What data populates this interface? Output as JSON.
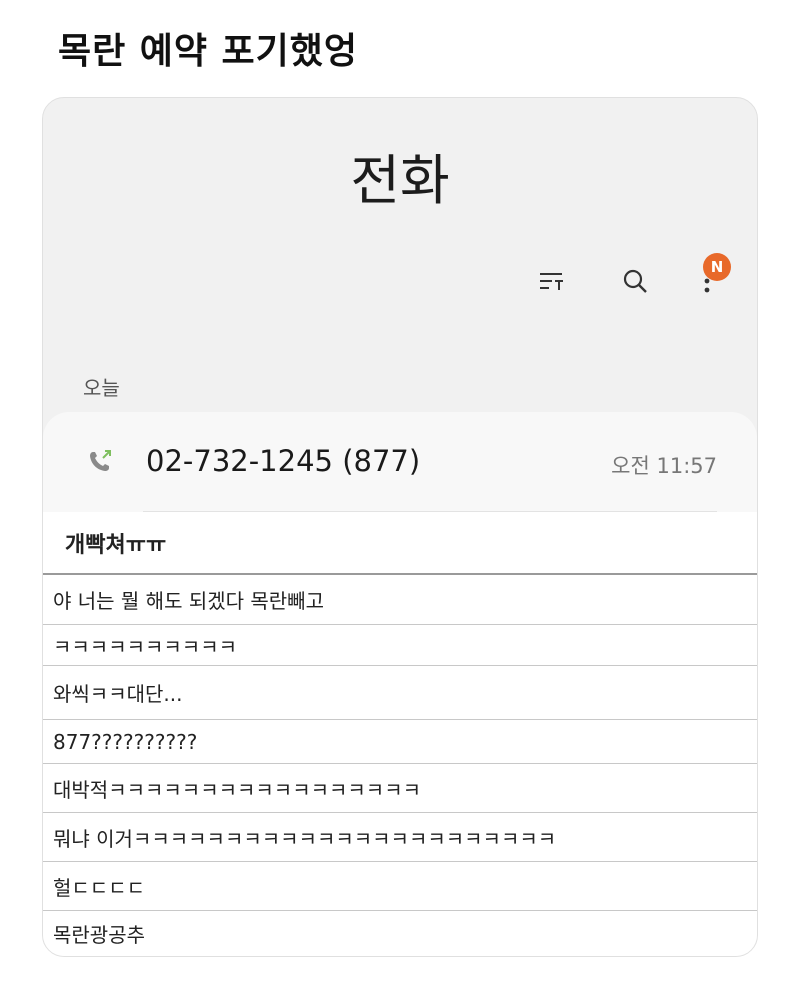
{
  "post": {
    "title": "목란 예약 포기했엉"
  },
  "app": {
    "title": "전화",
    "section_label": "오늘",
    "badge": "N"
  },
  "toolbar": {
    "icons": [
      "filter-icon",
      "search-icon",
      "more-icon"
    ]
  },
  "call": {
    "number": "02-732-1245 (877)",
    "time": "오전 11:57",
    "status_icon": "outgoing-call-icon",
    "status_color": "#7fbf5f"
  },
  "comments": [
    "개빡쳐ㅠㅠ",
    "야 너는 뭘 해도 되겠다 목란빼고",
    "ㅋㅋㅋㅋㅋㅋㅋㅋㅋㅋ",
    "와씩ㅋㅋ대단...",
    "877??????????",
    "대박적ㅋㅋㅋㅋㅋㅋㅋㅋㅋㅋㅋㅋㅋㅋㅋㅋㅋ",
    "뭐냐 이거ㅋㅋㅋㅋㅋㅋㅋㅋㅋㅋㅋㅋㅋㅋㅋㅋㅋㅋㅋㅋㅋㅋㅋ",
    "헐ㄷㄷㄷㄷ",
    "목란광공추"
  ],
  "colors": {
    "accent_badge": "#e8692a",
    "card_bg": "#f1f1f1"
  }
}
